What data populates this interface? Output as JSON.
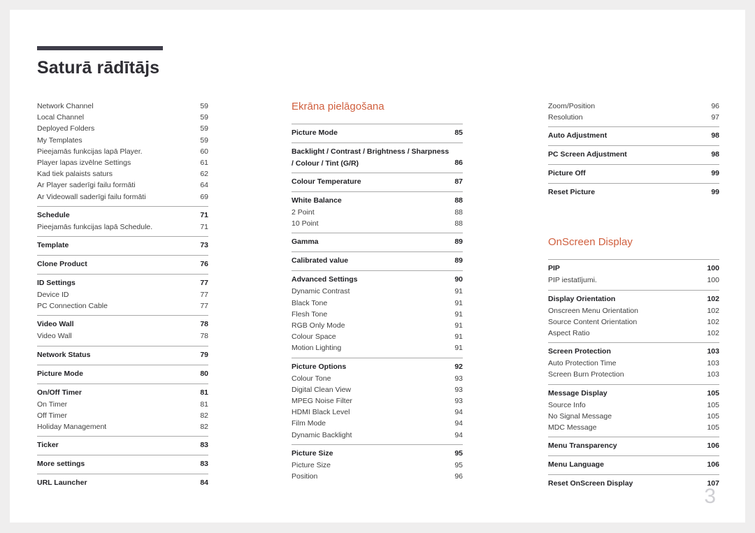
{
  "document": {
    "title": "Saturā rādītājs",
    "folio": "3",
    "accent_color": "#d0603f",
    "rule_color": "#3f3d49",
    "page_background": "#ffffff",
    "canvas_background": "#efeeee"
  },
  "columns": [
    {
      "id": "column-1",
      "heading": null,
      "groups": [
        {
          "rule": false,
          "entries": [
            {
              "level": "minor",
              "label": "Network Channel",
              "page": "59"
            },
            {
              "level": "minor",
              "label": "Local Channel",
              "page": "59"
            },
            {
              "level": "minor",
              "label": "Deployed Folders",
              "page": "59"
            },
            {
              "level": "minor",
              "label": "My Templates",
              "page": "59"
            },
            {
              "level": "minor",
              "label": "Pieejamās funkcijas lapā Player.",
              "page": "60"
            },
            {
              "level": "minor",
              "label": "Player lapas izvēlne Settings",
              "page": "61"
            },
            {
              "level": "minor",
              "label": "Kad tiek palaists saturs",
              "page": "62"
            },
            {
              "level": "minor",
              "label": "Ar Player saderīgi failu formāti",
              "page": "64"
            },
            {
              "level": "minor",
              "label": "Ar Videowall saderīgi failu formāti",
              "page": "69"
            }
          ]
        },
        {
          "rule": true,
          "entries": [
            {
              "level": "major",
              "label": "Schedule",
              "page": "71"
            },
            {
              "level": "minor",
              "label": "Pieejamās funkcijas lapā Schedule.",
              "page": "71"
            }
          ]
        },
        {
          "rule": true,
          "entries": [
            {
              "level": "major",
              "label": "Template",
              "page": "73"
            }
          ]
        },
        {
          "rule": true,
          "entries": [
            {
              "level": "major",
              "label": "Clone Product",
              "page": "76"
            }
          ]
        },
        {
          "rule": true,
          "entries": [
            {
              "level": "major",
              "label": "ID Settings",
              "page": "77"
            },
            {
              "level": "minor",
              "label": "Device ID",
              "page": "77"
            },
            {
              "level": "minor",
              "label": "PC Connection Cable",
              "page": "77"
            }
          ]
        },
        {
          "rule": true,
          "entries": [
            {
              "level": "major",
              "label": "Video Wall",
              "page": "78"
            },
            {
              "level": "minor",
              "label": "Video Wall",
              "page": "78"
            }
          ]
        },
        {
          "rule": true,
          "entries": [
            {
              "level": "major",
              "label": "Network Status",
              "page": "79"
            }
          ]
        },
        {
          "rule": true,
          "entries": [
            {
              "level": "major",
              "label": "Picture Mode",
              "page": "80"
            }
          ]
        },
        {
          "rule": true,
          "entries": [
            {
              "level": "major",
              "label": "On/Off Timer",
              "page": "81"
            },
            {
              "level": "minor",
              "label": "On Timer",
              "page": "81"
            },
            {
              "level": "minor",
              "label": "Off Timer",
              "page": "82"
            },
            {
              "level": "minor",
              "label": "Holiday Management",
              "page": "82"
            }
          ]
        },
        {
          "rule": true,
          "entries": [
            {
              "level": "major",
              "label": "Ticker",
              "page": "83"
            }
          ]
        },
        {
          "rule": true,
          "entries": [
            {
              "level": "major",
              "label": "More settings",
              "page": "83"
            }
          ]
        },
        {
          "rule": true,
          "entries": [
            {
              "level": "major",
              "label": "URL Launcher",
              "page": "84"
            }
          ]
        }
      ]
    },
    {
      "id": "column-2",
      "heading": "Ekrāna pielāgošana",
      "groups": [
        {
          "rule": true,
          "entries": [
            {
              "level": "major",
              "label": "Picture Mode",
              "page": "85"
            }
          ]
        },
        {
          "rule": true,
          "entries": [
            {
              "level": "major",
              "two_line": true,
              "label": "Backlight / Contrast / Brightness / Sharpness / Colour / Tint (G/R)",
              "page": "86"
            }
          ]
        },
        {
          "rule": true,
          "entries": [
            {
              "level": "major",
              "label": "Colour Temperature",
              "page": "87"
            }
          ]
        },
        {
          "rule": true,
          "entries": [
            {
              "level": "major",
              "label": "White Balance",
              "page": "88"
            },
            {
              "level": "minor",
              "label": "2 Point",
              "page": "88"
            },
            {
              "level": "minor",
              "label": "10 Point",
              "page": "88"
            }
          ]
        },
        {
          "rule": true,
          "entries": [
            {
              "level": "major",
              "label": "Gamma",
              "page": "89"
            }
          ]
        },
        {
          "rule": true,
          "entries": [
            {
              "level": "major",
              "label": "Calibrated value",
              "page": "89"
            }
          ]
        },
        {
          "rule": true,
          "entries": [
            {
              "level": "major",
              "label": "Advanced Settings",
              "page": "90"
            },
            {
              "level": "minor",
              "label": "Dynamic Contrast",
              "page": "91"
            },
            {
              "level": "minor",
              "label": "Black Tone",
              "page": "91"
            },
            {
              "level": "minor",
              "label": "Flesh Tone",
              "page": "91"
            },
            {
              "level": "minor",
              "label": "RGB Only Mode",
              "page": "91"
            },
            {
              "level": "minor",
              "label": "Colour Space",
              "page": "91"
            },
            {
              "level": "minor",
              "label": "Motion Lighting",
              "page": "91"
            }
          ]
        },
        {
          "rule": true,
          "entries": [
            {
              "level": "major",
              "label": "Picture Options",
              "page": "92"
            },
            {
              "level": "minor",
              "label": "Colour Tone",
              "page": "93"
            },
            {
              "level": "minor",
              "label": "Digital Clean View",
              "page": "93"
            },
            {
              "level": "minor",
              "label": "MPEG Noise Filter",
              "page": "93"
            },
            {
              "level": "minor",
              "label": "HDMI Black Level",
              "page": "94"
            },
            {
              "level": "minor",
              "label": "Film Mode",
              "page": "94"
            },
            {
              "level": "minor",
              "label": "Dynamic Backlight",
              "page": "94"
            }
          ]
        },
        {
          "rule": true,
          "entries": [
            {
              "level": "major",
              "label": "Picture Size",
              "page": "95"
            },
            {
              "level": "minor",
              "label": "Picture Size",
              "page": "95"
            },
            {
              "level": "minor",
              "label": "Position",
              "page": "96"
            }
          ]
        }
      ]
    },
    {
      "id": "column-3",
      "heading": null,
      "groups": [
        {
          "rule": false,
          "entries": [
            {
              "level": "minor",
              "label": "Zoom/Position",
              "page": "96"
            },
            {
              "level": "minor",
              "label": "Resolution",
              "page": "97"
            }
          ]
        },
        {
          "rule": true,
          "entries": [
            {
              "level": "major",
              "label": "Auto Adjustment",
              "page": "98"
            }
          ]
        },
        {
          "rule": true,
          "entries": [
            {
              "level": "major",
              "label": "PC Screen Adjustment",
              "page": "98"
            }
          ]
        },
        {
          "rule": true,
          "entries": [
            {
              "level": "major",
              "label": "Picture Off",
              "page": "99"
            }
          ]
        },
        {
          "rule": true,
          "entries": [
            {
              "level": "major",
              "label": "Reset Picture",
              "page": "99"
            }
          ]
        }
      ],
      "heading2": "OnScreen Display",
      "groups2": [
        {
          "rule": true,
          "entries": [
            {
              "level": "major",
              "label": "PIP",
              "page": "100"
            },
            {
              "level": "minor",
              "label": "PIP iestatījumi.",
              "page": "100"
            }
          ]
        },
        {
          "rule": true,
          "entries": [
            {
              "level": "major",
              "label": "Display Orientation",
              "page": "102"
            },
            {
              "level": "minor",
              "label": "Onscreen Menu Orientation",
              "page": "102"
            },
            {
              "level": "minor",
              "label": "Source Content Orientation",
              "page": "102"
            },
            {
              "level": "minor",
              "label": "Aspect Ratio",
              "page": "102"
            }
          ]
        },
        {
          "rule": true,
          "entries": [
            {
              "level": "major",
              "label": "Screen Protection",
              "page": "103"
            },
            {
              "level": "minor",
              "label": "Auto Protection Time",
              "page": "103"
            },
            {
              "level": "minor",
              "label": "Screen Burn Protection",
              "page": "103"
            }
          ]
        },
        {
          "rule": true,
          "entries": [
            {
              "level": "major",
              "label": "Message Display",
              "page": "105"
            },
            {
              "level": "minor",
              "label": "Source Info",
              "page": "105"
            },
            {
              "level": "minor",
              "label": "No Signal Message",
              "page": "105"
            },
            {
              "level": "minor",
              "label": "MDC Message",
              "page": "105"
            }
          ]
        },
        {
          "rule": true,
          "entries": [
            {
              "level": "major",
              "label": "Menu Transparency",
              "page": "106"
            }
          ]
        },
        {
          "rule": true,
          "entries": [
            {
              "level": "major",
              "label": "Menu Language",
              "page": "106"
            }
          ]
        },
        {
          "rule": true,
          "entries": [
            {
              "level": "major",
              "label": "Reset OnScreen Display",
              "page": "107"
            }
          ]
        }
      ]
    }
  ]
}
